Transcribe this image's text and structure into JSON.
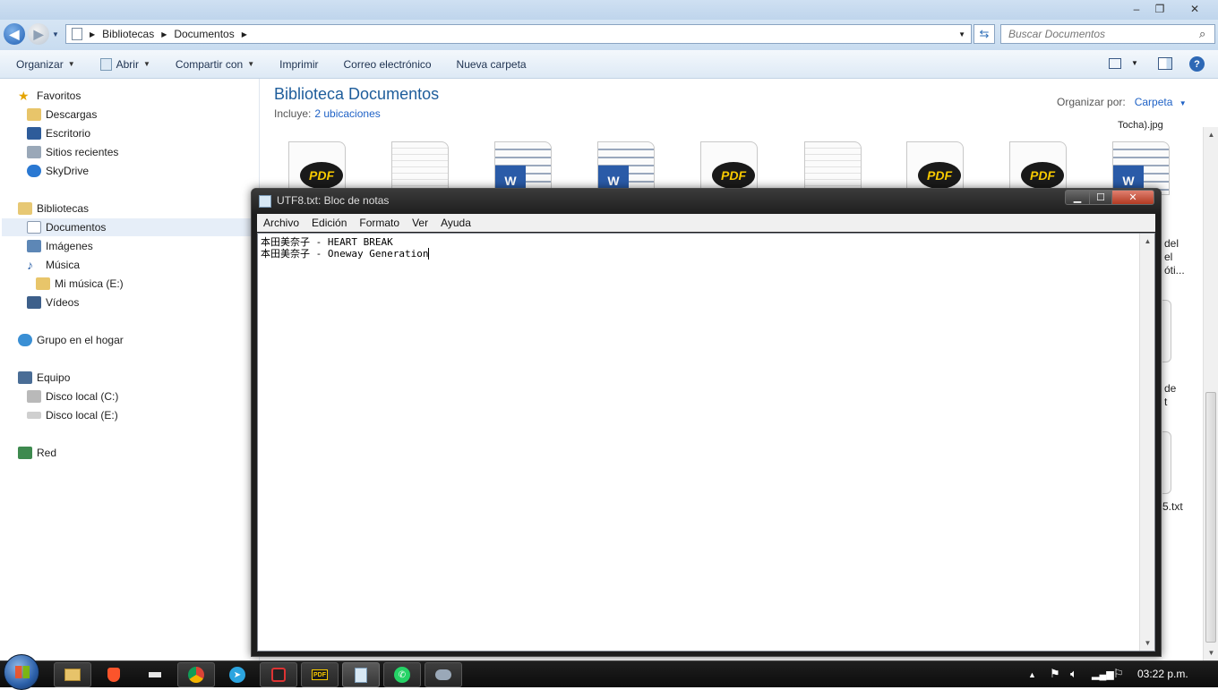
{
  "explorer": {
    "address": {
      "segments": [
        "Bibliotecas",
        "Documentos"
      ]
    },
    "search": {
      "placeholder": "Buscar Documentos"
    },
    "toolbar": [
      {
        "label": "Organizar",
        "has_menu": true
      },
      {
        "label": "Abrir",
        "has_menu": true
      },
      {
        "label": "Compartir con",
        "has_menu": true
      },
      {
        "label": "Imprimir",
        "has_menu": false
      },
      {
        "label": "Correo electrónico",
        "has_menu": false
      },
      {
        "label": "Nueva carpeta",
        "has_menu": false
      }
    ],
    "nav": {
      "favoritos": "Favoritos",
      "descargas": "Descargas",
      "escritorio": "Escritorio",
      "sitios": "Sitios recientes",
      "skydrive": "SkyDrive",
      "bibliotecas": "Bibliotecas",
      "documentos": "Documentos",
      "imagenes": "Imágenes",
      "musica": "Música",
      "mimusica": "Mi música (E:)",
      "videos": "Vídeos",
      "grupo": "Grupo en el hogar",
      "equipo": "Equipo",
      "discoc": "Disco local (C:)",
      "discoe": "Disco local  (E:)",
      "red": "Red"
    },
    "library": {
      "title": "Biblioteca Documentos",
      "includes_label": "Incluye:",
      "includes_link": "2 ubicaciones",
      "arrange_label": "Organizar por:",
      "arrange_value": "Carpeta"
    },
    "files": [
      {
        "type": "pdf"
      },
      {
        "type": "txt"
      },
      {
        "type": "word"
      },
      {
        "type": "word"
      },
      {
        "type": "pdf"
      },
      {
        "type": "txt"
      },
      {
        "type": "pdf"
      },
      {
        "type": "pdf"
      },
      {
        "type": "word"
      }
    ],
    "partial_labels": {
      "top": "Tocha).jpg",
      "l1": "del",
      "l2": "el",
      "l3": "óti...",
      "l4": "de",
      "l5": "t",
      "l6": "5.txt"
    }
  },
  "notepad": {
    "title": "UTF8.txt: Bloc de notas",
    "menu": [
      "Archivo",
      "Edición",
      "Formato",
      "Ver",
      "Ayuda"
    ],
    "lines": [
      "本田美奈子 - HEART BREAK",
      "本田美奈子 - Oneway Generation"
    ]
  },
  "taskbar": {
    "clock": "03:22 p.m."
  },
  "colors": {
    "accent_title": "#1e5d9b",
    "link": "#1f62c6",
    "taskbar": "#141414"
  }
}
